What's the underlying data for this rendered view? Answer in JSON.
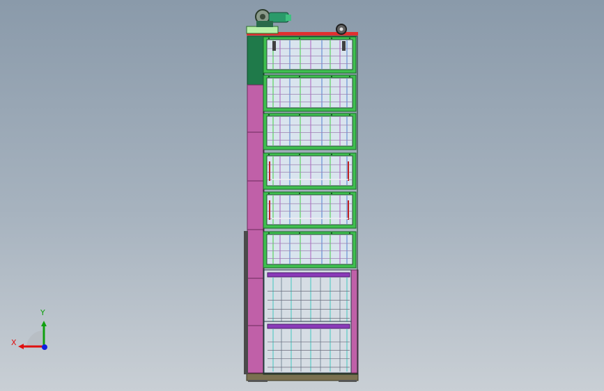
{
  "view": {
    "background_top": "#8a9aaa",
    "background_bottom": "#c9cfd5"
  },
  "model": {
    "colors": {
      "frame_green": "#3fbf4f",
      "frame_dark_green": "#1f7a4a",
      "side_panel_magenta": "#c060a8",
      "top_rail_red": "#e03030",
      "base_olive": "#7a7050",
      "glass": "#d9e4ee",
      "tray_purple": "#8a3ab8",
      "motor_teal": "#2a9a6a"
    },
    "shelf_count": 6,
    "lower_bay_count": 2
  },
  "triad": {
    "x_label": "X",
    "y_label": "Y",
    "x_color": "#e01010",
    "y_color": "#10a010",
    "z_color": "#1020e0"
  }
}
